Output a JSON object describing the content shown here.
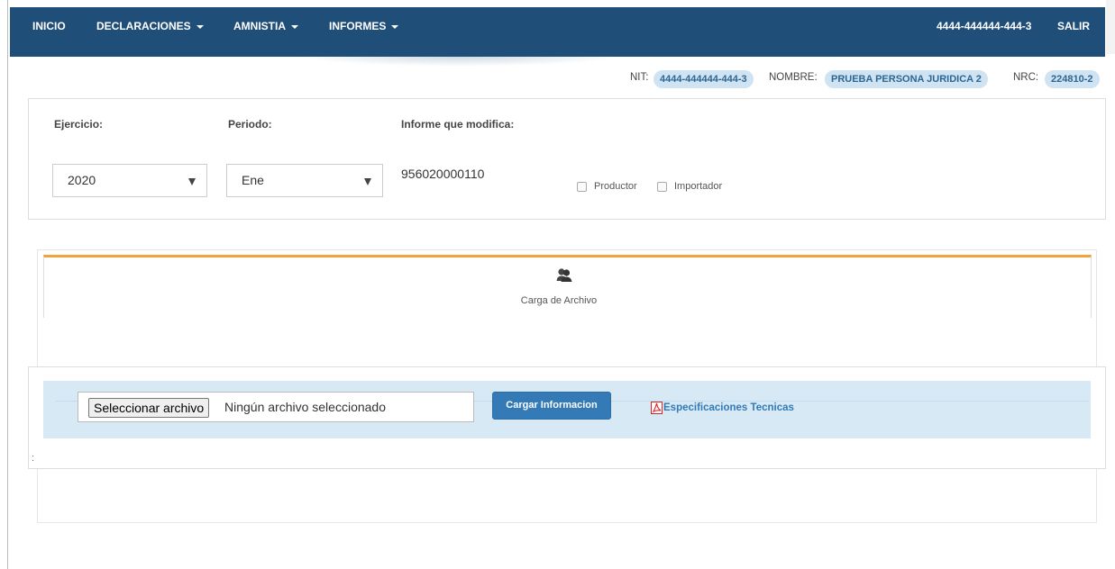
{
  "nav": {
    "items": [
      {
        "label": "INICIO"
      },
      {
        "label": "DECLARACIONES"
      },
      {
        "label": "AMNISTIA"
      },
      {
        "label": "INFORMES"
      }
    ],
    "user_nit": "4444-444444-444-3",
    "logout_label": "SALIR"
  },
  "taxpayer": {
    "nit_label": "NIT:",
    "nit": "4444-444444-444-3",
    "nombre_label": "NOMBRE:",
    "nombre": "PRUEBA PERSONA JURIDICA 2",
    "nrc_label": "NRC:",
    "nrc": "224810-2"
  },
  "filters": {
    "ejercicio_label": "Ejercicio:",
    "ejercicio_value": "2020",
    "periodo_label": "Periodo:",
    "periodo_value": "Ene",
    "informe_label": "Informe que modifica:",
    "informe_value": "956020000110",
    "productor_label": "Productor",
    "importador_label": "Importador"
  },
  "upload": {
    "tab_label": "Carga de Archivo",
    "choose_button": "Seleccionar archivo",
    "no_file_text": "Ningún archivo seleccionado",
    "submit_button": "Cargar Informacion",
    "spec_link": "Especificaciones Tecnicas",
    "stray_text": ":"
  },
  "colors": {
    "navbar": "#1f4e79",
    "pill_bg": "#cfe3f2",
    "pill_text": "#2c6693",
    "tab_accent": "#f0a43a",
    "stripe": "#d6e9f5",
    "primary": "#337ab7",
    "pdf": "#e02020"
  },
  "icons": {
    "tab": "users-icon",
    "spec": "pdf-icon"
  }
}
